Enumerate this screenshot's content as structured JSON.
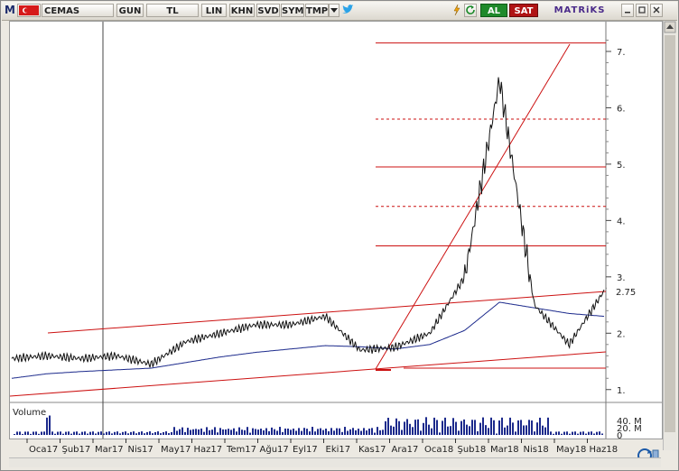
{
  "toolbar": {
    "m_label": "M",
    "symbol": "CEMAS",
    "period": "GUN",
    "currency": "TL",
    "scale": "LIN",
    "khn": "KHN",
    "svd": "SVD",
    "sym": "SYM",
    "tmp": "TMP",
    "al": "AL",
    "sat": "SAT",
    "brand": "MATRiKS"
  },
  "axis": {
    "y_ticks": [
      "1.",
      "2.",
      "3.",
      "4.",
      "5.",
      "6.",
      "7."
    ],
    "current_price": "2.75",
    "volume_label": "Volume",
    "volume_ticks": [
      "40. M",
      "20. M",
      "0"
    ],
    "x_ticks": [
      "Oca17",
      "Şub17",
      "Mar17",
      "Nis17",
      "May17",
      "Haz17",
      "Tem17",
      "Ağu17",
      "Eyl17",
      "Eki17",
      "Kas17",
      "Ara17",
      "Oca18",
      "Şub18",
      "Mar18",
      "Nis18",
      "May18",
      "Haz18"
    ]
  },
  "colors": {
    "price": "#111111",
    "moving_average": "#1c2a8c",
    "trend": "#cc1111",
    "volume": "#1c2a8c"
  },
  "chart_data": {
    "type": "line",
    "x": [
      "2017-01",
      "2017-02",
      "2017-03",
      "2017-04",
      "2017-05",
      "2017-06",
      "2017-07",
      "2017-08",
      "2017-09",
      "2017-10",
      "2017-11",
      "2017-12",
      "2018-01",
      "2018-02",
      "2018-03",
      "2018-04",
      "2018-05",
      "2018-06"
    ],
    "series": [
      {
        "values": [
          1.55,
          1.6,
          1.55,
          1.6,
          1.45,
          1.85,
          2.0,
          2.15,
          2.15,
          2.3,
          1.7,
          1.75,
          2.0,
          3.0,
          6.5,
          2.5,
          1.8,
          2.75
        ]
      },
      {
        "values": [
          1.2,
          1.28,
          1.32,
          1.35,
          1.38,
          1.48,
          1.58,
          1.66,
          1.72,
          1.78,
          1.76,
          1.72,
          1.8,
          2.05,
          2.55,
          2.45,
          2.35,
          2.3
        ]
      }
    ],
    "y_range": [
      0.9,
      7.4
    ],
    "fibonacci_levels": [
      7.15,
      5.8,
      4.95,
      4.25,
      3.55
    ],
    "volume_range_millions": [
      0,
      50
    ]
  }
}
